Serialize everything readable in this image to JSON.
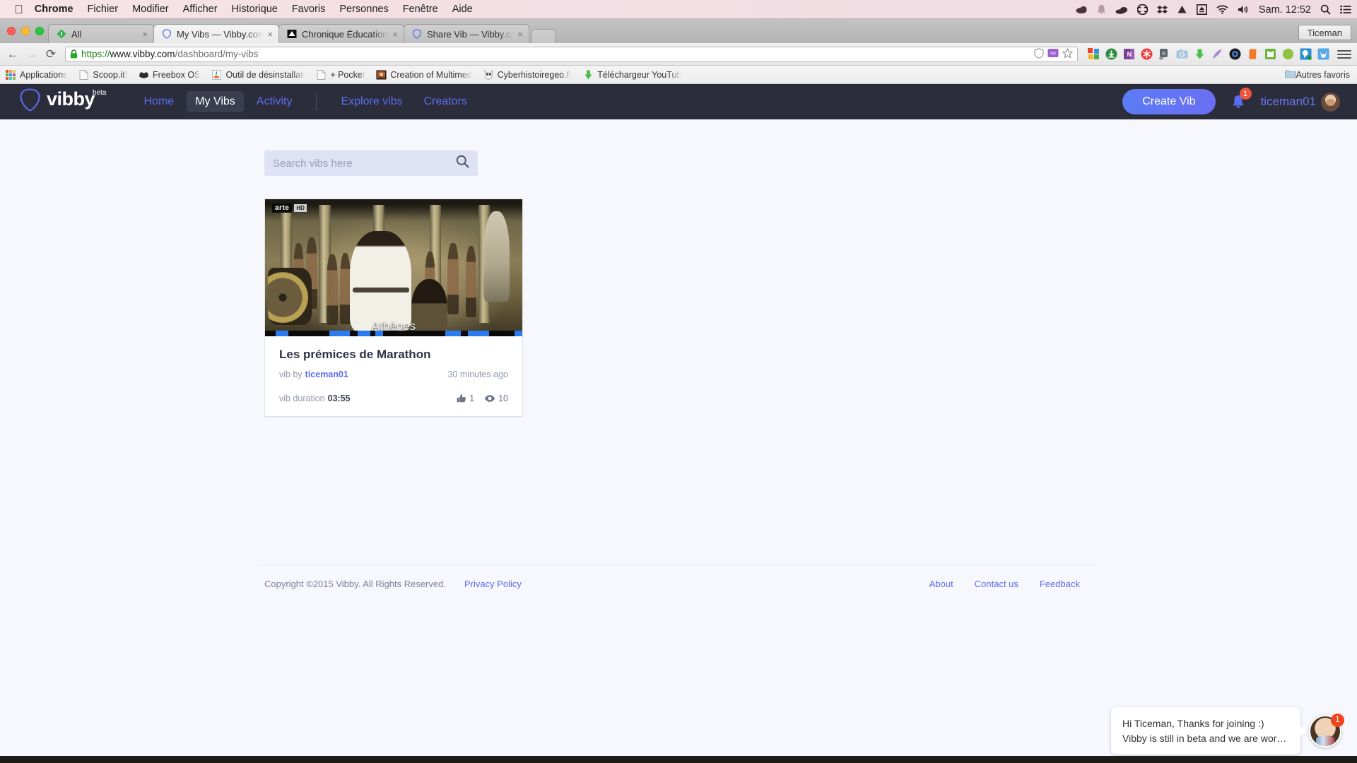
{
  "os": {
    "menubar": {
      "apple": "apple-logo",
      "items": [
        "Chrome",
        "Fichier",
        "Modifier",
        "Afficher",
        "Historique",
        "Favoris",
        "Personnes",
        "Fenêtre",
        "Aide"
      ],
      "app_name": "Chrome",
      "status_icons": [
        "cloud-dark-icon",
        "bell-icon",
        "onedrive-cloud-icon",
        "creative-cloud-icon",
        "dropbox-icon",
        "google-drive-icon",
        "eject-icon",
        "wifi-icon",
        "volume-icon"
      ],
      "clock": "Sam. 12:52",
      "spotlight_icon": "search-icon",
      "notification_center_icon": "list-icon"
    }
  },
  "browser": {
    "profile_button": "Ticeman",
    "tabs": [
      {
        "title": "All",
        "favicon": "feedly-icon",
        "active": false,
        "close": "×"
      },
      {
        "title": "My Vibs — Vibby.com",
        "favicon": "vibby-icon",
        "active": true,
        "close": "×"
      },
      {
        "title": "Chronique Éducation: Péda",
        "favicon": "blog-icon",
        "active": false,
        "close": "×"
      },
      {
        "title": "Share Vib — Vibby.com",
        "favicon": "vibby-icon",
        "active": false,
        "close": "×"
      }
    ],
    "toolbar": {
      "back_icon": "back-arrow-icon",
      "forward_icon": "forward-arrow-icon",
      "reload_icon": "reload-icon",
      "lock_icon": "lock-icon",
      "url": {
        "scheme": "https://",
        "host": "www.vibby.com",
        "path": "/dashboard/my-vibs"
      },
      "omnibox_inline_icons": [
        "shield-icon",
        "rw-puzzle-icon",
        "star-icon"
      ],
      "extension_icons": [
        "colorful-squares-icon",
        "download-green-icon",
        "onenote-icon",
        "red-asterisk-icon",
        "evernote-icon",
        "camera-icon",
        "green-down-arrow-icon",
        "purple-feather-icon",
        "black-lens-icon",
        "orange-book-icon",
        "green-print-icon",
        "green-circle-icon",
        "blue-chat-icon",
        "blue-fox-icon"
      ],
      "menu_icon": "hamburger-menu-icon"
    },
    "bookmarks": [
      {
        "label": "Applications",
        "icon": "apps-grid-icon"
      },
      {
        "label": "Scoop.it!",
        "icon": "page-icon"
      },
      {
        "label": "Freebox OS",
        "icon": "freebox-icon"
      },
      {
        "label": "Outil de désinstallati",
        "icon": "java-icon"
      },
      {
        "label": "+ Pocket",
        "icon": "page-icon"
      },
      {
        "label": "Creation of Multimed",
        "icon": "photo-icon"
      },
      {
        "label": "Cyberhistoiregeo.fr",
        "icon": "owl-icon"
      },
      {
        "label": "Téléchargeur YouTub",
        "icon": "green-down-arrow-icon"
      }
    ],
    "bookmarks_right": {
      "label": "Autres favoris",
      "icon": "folder-icon"
    }
  },
  "site": {
    "nav": {
      "logo": {
        "wordmark": "vibby",
        "beta": "beta",
        "icon": "vibby-shield-icon"
      },
      "links": [
        {
          "label": "Home",
          "active": false
        },
        {
          "label": "My Vibs",
          "active": true
        },
        {
          "label": "Activity",
          "active": false
        }
      ],
      "links_secondary": [
        {
          "label": "Explore vibs"
        },
        {
          "label": "Creators"
        }
      ],
      "create_button": "Create Vib",
      "bell_icon": "bell-icon",
      "bell_badge": "1",
      "username": "ticeman01",
      "avatar_icon": "user-avatar"
    },
    "search": {
      "placeholder": "Search vibs here",
      "value": "",
      "icon": "search-icon"
    },
    "cards": [
      {
        "title": "Les prémices de Marathon",
        "by_label": "vib by",
        "author": "ticeman01",
        "time_ago": "30 minutes ago",
        "duration_label": "vib duration",
        "duration": "03:55",
        "likes": "1",
        "views": "10",
        "like_icon": "thumbs-up-icon",
        "view_icon": "eye-icon",
        "thumbnail": {
          "channel_word": "arte",
          "channel_hd": "HD",
          "caption": "Athènes"
        }
      }
    ],
    "footer": {
      "copyright": "Copyright ©2015 Vibby. All Rights Reserved.",
      "privacy": "Privacy Policy",
      "links": [
        "About",
        "Contact us",
        "Feedback"
      ]
    },
    "chat": {
      "line1": "Hi Ticeman, Thanks for joining :)",
      "line2": "Vibby is still in beta and we are wor…",
      "badge": "1",
      "avatar_icon": "support-agent-avatar"
    }
  },
  "colors": {
    "nav_bg": "#2b2d3a",
    "accent": "#5b6cf0",
    "page_bg": "#f7f8fd",
    "badge_red": "#f0543c",
    "search_bg": "#dee2f4"
  }
}
